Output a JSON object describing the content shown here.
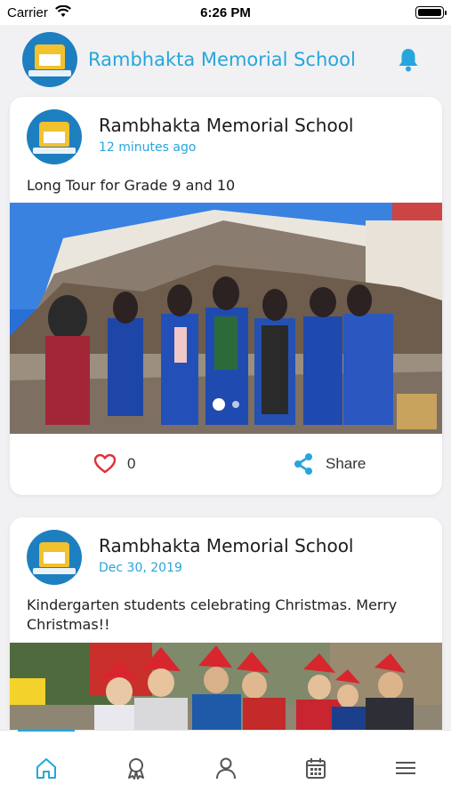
{
  "status_bar": {
    "carrier": "Carrier",
    "time": "6:26 PM"
  },
  "header": {
    "title": "Rambhakta Memorial School"
  },
  "posts": [
    {
      "author": "Rambhakta Memorial School",
      "time": "12 minutes ago",
      "text": "Long Tour for Grade 9 and 10",
      "likes": "0",
      "share_label": "Share"
    },
    {
      "author": "Rambhakta Memorial School",
      "time": "Dec 30, 2019",
      "text": "Kindergarten students celebrating Christmas. Merry Christmas!!"
    }
  ],
  "icons": {
    "bell": "bell-icon",
    "like": "heart-icon",
    "share": "share-icon",
    "tabs": [
      "home-icon",
      "award-icon",
      "user-icon",
      "calendar-icon",
      "menu-icon"
    ]
  },
  "colors": {
    "accent": "#26a6dc",
    "like": "#e0313b",
    "background": "#f1f1f3"
  }
}
